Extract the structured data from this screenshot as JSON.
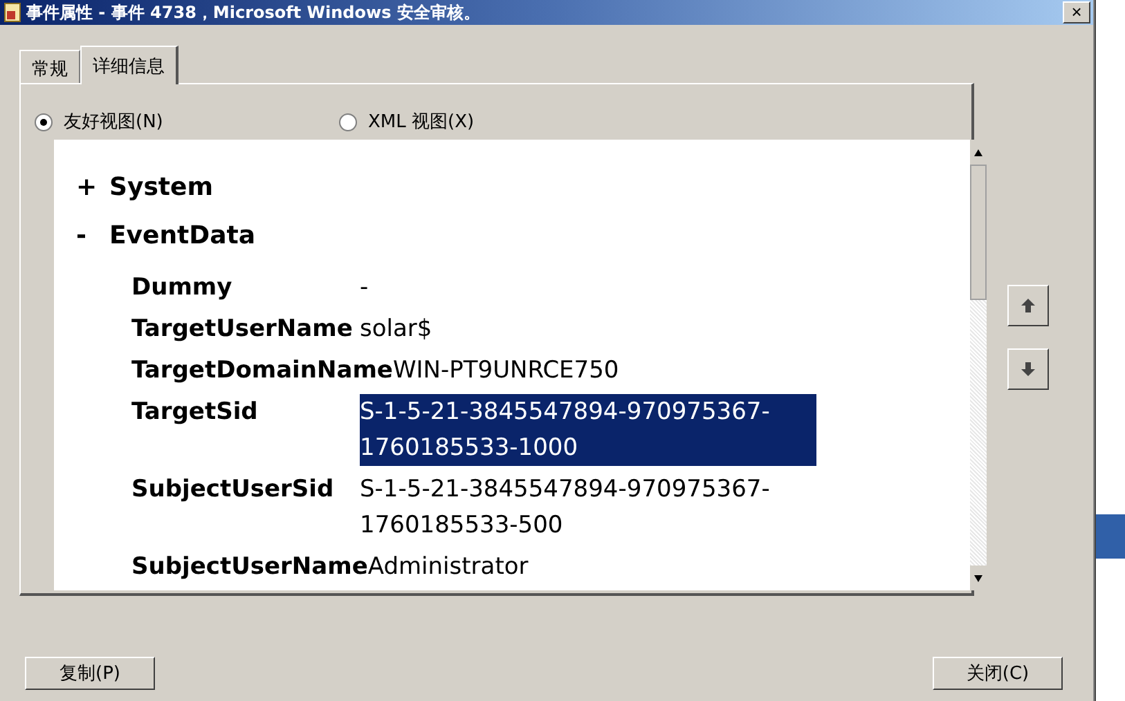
{
  "window": {
    "title": "事件属性 - 事件 4738，Microsoft Windows 安全审核。",
    "close": "×"
  },
  "tabs": [
    {
      "label": "常规",
      "selected": false
    },
    {
      "label": "详细信息",
      "selected": true
    }
  ],
  "view_options": [
    {
      "label": "友好视图(N)",
      "selected": true
    },
    {
      "label": "XML 视图(X)",
      "selected": false
    }
  ],
  "tree": [
    {
      "toggle": "+",
      "label": "System"
    },
    {
      "toggle": "-",
      "label": "EventData",
      "children": [
        {
          "name": "Dummy",
          "value": "-",
          "selected": false
        },
        {
          "name": "TargetUserName",
          "value": "solar$",
          "selected": false
        },
        {
          "name": "TargetDomainName",
          "value": "WIN-PT9UNRCE750",
          "selected": false
        },
        {
          "name": "TargetSid",
          "value": "S-1-5-21-3845547894-970975367-1760185533-1000",
          "selected": true
        },
        {
          "name": "SubjectUserSid",
          "value": "S-1-5-21-3845547894-970975367-1760185533-500",
          "selected": false
        },
        {
          "name": "SubjectUserName",
          "value": "Administrator",
          "selected": false
        }
      ]
    }
  ],
  "buttons": [
    {
      "label": "复制(P)"
    },
    {
      "label": "关闭(C)"
    }
  ]
}
